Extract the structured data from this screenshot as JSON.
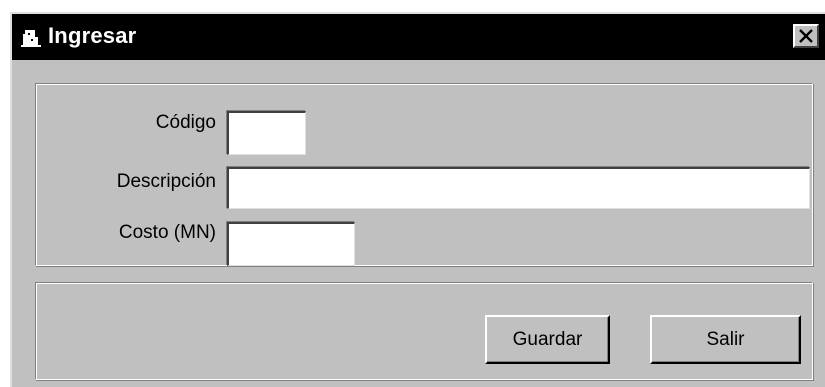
{
  "window": {
    "title": "Ingresar",
    "icon": "app-window-icon",
    "close_icon": "close-icon"
  },
  "form": {
    "codigo_label": "Código",
    "codigo_value": "",
    "descripcion_label": "Descripción",
    "descripcion_value": "",
    "costo_label": "Costo (MN)",
    "costo_value": ""
  },
  "buttons": {
    "guardar_label": "Guardar",
    "salir_label": "Salir"
  },
  "colors": {
    "titlebar": "#000000",
    "face": "#c0c0c0",
    "field": "#ffffff"
  }
}
